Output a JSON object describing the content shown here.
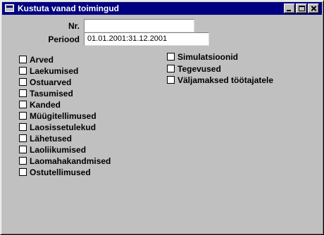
{
  "window": {
    "title": "Kustuta vanad toimingud"
  },
  "form": {
    "nr_label": "Nr.",
    "nr_value": "",
    "period_label": "Periood",
    "period_value": "01.01.2001:31.12.2001"
  },
  "checkboxes_left": [
    {
      "label": "Arved",
      "checked": false
    },
    {
      "label": "Laekumised",
      "checked": false
    },
    {
      "label": "Ostuarved",
      "checked": false
    },
    {
      "label": "Tasumised",
      "checked": false
    },
    {
      "label": "Kanded",
      "checked": false
    },
    {
      "label": "Müügitellimused",
      "checked": false
    },
    {
      "label": "Laosissetulekud",
      "checked": false
    },
    {
      "label": "Lähetused",
      "checked": false
    },
    {
      "label": "Laoliikumised",
      "checked": false
    },
    {
      "label": "Laomahakandmised",
      "checked": false
    },
    {
      "label": "Ostutellimused",
      "checked": false
    }
  ],
  "checkboxes_right": [
    {
      "label": "Simulatsioonid",
      "checked": false
    },
    {
      "label": "Tegevused",
      "checked": false
    },
    {
      "label": "Väljamaksed töötajatele",
      "checked": false
    }
  ]
}
